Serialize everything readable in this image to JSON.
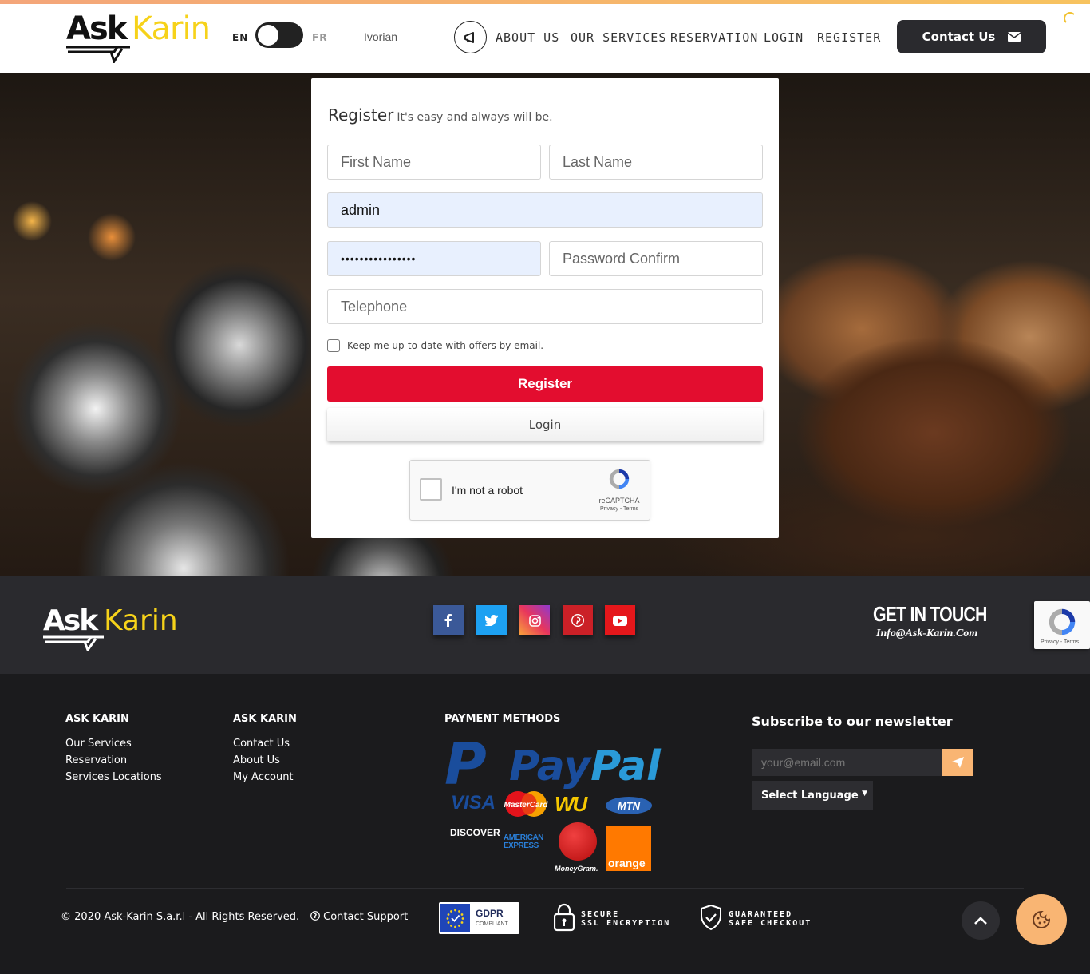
{
  "header": {
    "logo": {
      "ask": "Ask",
      "karin": "Karin"
    },
    "lang_en": "EN",
    "lang_fr": "FR",
    "lang_extra": "Ivorian",
    "nav": [
      "ABOUT US",
      "OUR SERVICES",
      "RESERVATION",
      "LOGIN",
      "REGISTER"
    ],
    "contact_label": "Contact Us"
  },
  "form": {
    "title": "Register",
    "subtitle": "It's easy and always will be.",
    "first_name_placeholder": "First Name",
    "last_name_placeholder": "Last Name",
    "username_value": "admin",
    "password_value": "••••••••••••••••",
    "password_confirm_placeholder": "Password Confirm",
    "telephone_placeholder": "Telephone",
    "newsletter_checkbox_label": "Keep me up-to-date with offers by email.",
    "register_label": "Register",
    "login_label": "Login",
    "captcha_label": "I'm not a robot",
    "captcha_brand": "reCAPTCHA",
    "captcha_links": "Privacy - Terms"
  },
  "footer_bar": {
    "logo": {
      "ask": "Ask",
      "karin": "Karin"
    },
    "social": [
      "facebook-icon",
      "twitter-icon",
      "instagram-icon",
      "pinterest-icon",
      "youtube-icon"
    ],
    "get_in_touch": "GET IN TOUCH",
    "email": "Info@Ask-Karin.Com",
    "badge_links": "Privacy - Terms"
  },
  "footer": {
    "col1": {
      "title": "ASK KARIN",
      "links": [
        "Our Services",
        "Reservation",
        "Services Locations"
      ]
    },
    "col2": {
      "title": "ASK KARIN",
      "links": [
        "Contact Us",
        "About Us",
        "My Account"
      ]
    },
    "payment": {
      "title": "PAYMENT METHODS",
      "paypal_p": "P",
      "paypal_1": "Pay",
      "paypal_2": "Pal",
      "visa": "VISA",
      "mastercard": "MasterCard",
      "wu": "WU",
      "mtn": "MTN",
      "discover": "DISCOVER",
      "amex_1": "AMERICAN",
      "amex_2": "EXPRESS",
      "moneygram": "MoneyGram.",
      "orange": "orange"
    },
    "newsletter": {
      "title": "Subscribe to our newsletter",
      "email_placeholder": "your@email.com",
      "language_select": "Select Language"
    },
    "copyright": "© 2020 Ask-Karin S.a.r.l - All Rights Reserved.",
    "support": "Contact Support",
    "gdpr_title": "GDPR",
    "gdpr_sub": "COMPLIANT",
    "ssl_1": "SECURE",
    "ssl_2": "SSL ENCRYPTION",
    "safe_1": "GUARANTEED",
    "safe_2": "SAFE CHECKOUT"
  },
  "colors": {
    "brand_yellow": "#f6d21a",
    "register_red": "#e30d2f",
    "dark": "#2a2a2e",
    "accent_orange": "#f9b573"
  }
}
